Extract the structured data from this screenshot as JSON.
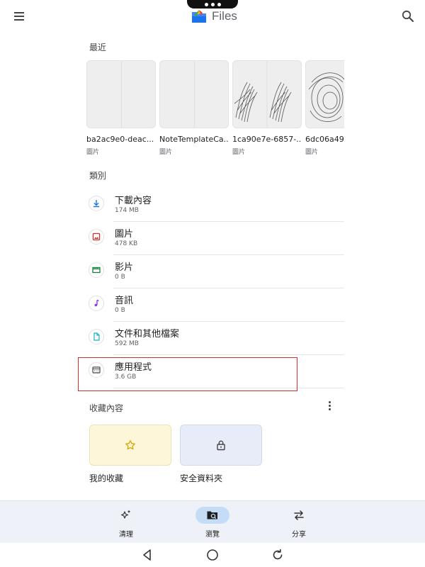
{
  "app": {
    "title": "Files"
  },
  "sections": {
    "recent": "最近",
    "categories": "類別",
    "collections": "收藏內容"
  },
  "recent_items": [
    {
      "name": "ba2ac9e0-deac...",
      "type": "圖片"
    },
    {
      "name": "NoteTemplateCa...",
      "type": "圖片"
    },
    {
      "name": "1ca90e7e-6857-...",
      "type": "圖片"
    },
    {
      "name": "6dc06a49-",
      "type": "圖片"
    }
  ],
  "categories": [
    {
      "label": "下載內容",
      "size": "174 MB",
      "icon": "download-icon",
      "color": "#1a73e8"
    },
    {
      "label": "圖片",
      "size": "478 KB",
      "icon": "image-icon",
      "color": "#d93025"
    },
    {
      "label": "影片",
      "size": "0 B",
      "icon": "video-icon",
      "color": "#188038"
    },
    {
      "label": "音訊",
      "size": "0 B",
      "icon": "music-icon",
      "color": "#9334e6"
    },
    {
      "label": "文件和其他檔案",
      "size": "592 MB",
      "icon": "document-icon",
      "color": "#12b5cb"
    },
    {
      "label": "應用程式",
      "size": "3.6 GB",
      "icon": "apps-icon",
      "color": "#444746"
    }
  ],
  "collections": [
    {
      "label": "我的收藏",
      "icon": "star-icon"
    },
    {
      "label": "安全資料夾",
      "icon": "lock-icon"
    }
  ],
  "bottom_nav": [
    {
      "label": "清理",
      "icon": "sparkle-icon"
    },
    {
      "label": "瀏覽",
      "icon": "browse-folder-icon",
      "active": true
    },
    {
      "label": "分享",
      "icon": "swap-arrows-icon"
    }
  ],
  "colors": {
    "highlight": "#d32f2f",
    "active_pill": "#c5dcf7",
    "nav_bg": "#eef2f8"
  }
}
